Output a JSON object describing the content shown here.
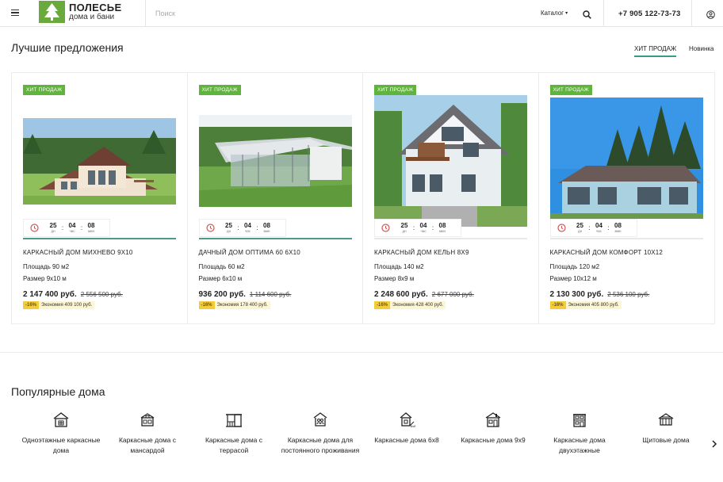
{
  "header": {
    "logo_title": "ПОЛЕСЬЕ",
    "logo_subtitle": "дома и бани",
    "search_placeholder": "Поиск",
    "catalog_label": "Каталог",
    "phone": "+7 905 122-73-73"
  },
  "best_offers": {
    "title": "Лучшие предложения",
    "tabs": [
      {
        "label": "ХИТ ПРОДАЖ",
        "active": true
      },
      {
        "label": "Новинка",
        "active": false
      }
    ],
    "cards": [
      {
        "badge": "ХИТ ПРОДАЖ",
        "timer": {
          "days": "25",
          "hours": "04",
          "minutes": "08",
          "days_unit": "дн",
          "hours_unit": "час",
          "minutes_unit": "мин"
        },
        "name": "КАРКАСНЫЙ ДОМ МИХНЕВО 9Х10",
        "area": "Площадь 90 м2",
        "size": "Размер 9х10 м",
        "price": "2 147 400 руб.",
        "old_price": "2 556 500 руб.",
        "discount": "-16%",
        "saving": "Экономия 409 100 руб."
      },
      {
        "badge": "ХИТ ПРОДАЖ",
        "timer": {
          "days": "25",
          "hours": "04",
          "minutes": "08",
          "days_unit": "дн",
          "hours_unit": "час",
          "minutes_unit": "мин"
        },
        "name": "ДАЧНЫЙ ДОМ ОПТИМА 60 6Х10",
        "area": "Площадь 60 м2",
        "size": "Размер 6х10 м",
        "price": "936 200 руб.",
        "old_price": "1 114 600 руб.",
        "discount": "-16%",
        "saving": "Экономия 178 400 руб."
      },
      {
        "badge": "ХИТ ПРОДАЖ",
        "timer": {
          "days": "25",
          "hours": "04",
          "minutes": "08",
          "days_unit": "дн",
          "hours_unit": "час",
          "minutes_unit": "мин"
        },
        "name": "КАРКАСНЫЙ ДОМ КЕЛЬН 8Х9",
        "area": "Площадь 140 м2",
        "size": "Размер 8х9 м",
        "price": "2 248 600 руб.",
        "old_price": "2 677 000 руб.",
        "discount": "-16%",
        "saving": "Экономия 428 400 руб."
      },
      {
        "badge": "ХИТ ПРОДАЖ",
        "timer": {
          "days": "25",
          "hours": "04",
          "minutes": "08",
          "days_unit": "дн",
          "hours_unit": "час",
          "minutes_unit": "мин"
        },
        "name": "КАРКАСНЫЙ ДОМ КОМФОРТ 10Х12",
        "area": "Площадь 120 м2",
        "size": "Размер 10х12 м",
        "price": "2 130 300 руб.",
        "old_price": "2 536 100 руб.",
        "discount": "-16%",
        "saving": "Экономия 405 800 руб."
      }
    ]
  },
  "popular": {
    "title": "Популярные дома",
    "items": [
      {
        "label": "Одноэтажные каркасные дома",
        "icon": "house-icon"
      },
      {
        "label": "Каркасные дома с мансардой",
        "icon": "attic-house-icon"
      },
      {
        "label": "Каркасные дома с террасой",
        "icon": "terrace-icon"
      },
      {
        "label": "Каркасные дома для постоянного проживания",
        "icon": "house-people-icon"
      },
      {
        "label": "Каркасные дома 6х8",
        "icon": "house-size-icon"
      },
      {
        "label": "Каркасные дома 9х9",
        "icon": "house-big-icon"
      },
      {
        "label": "Каркасные дома двухэтажные",
        "icon": "two-storey-icon"
      },
      {
        "label": "Щитовые дома",
        "icon": "panel-house-icon"
      }
    ]
  },
  "colors": {
    "accent_green": "#5fb43c",
    "tab_underline": "#3b9a86",
    "discount_yellow": "#f4cc3a",
    "timer_red": "#d9534f"
  }
}
